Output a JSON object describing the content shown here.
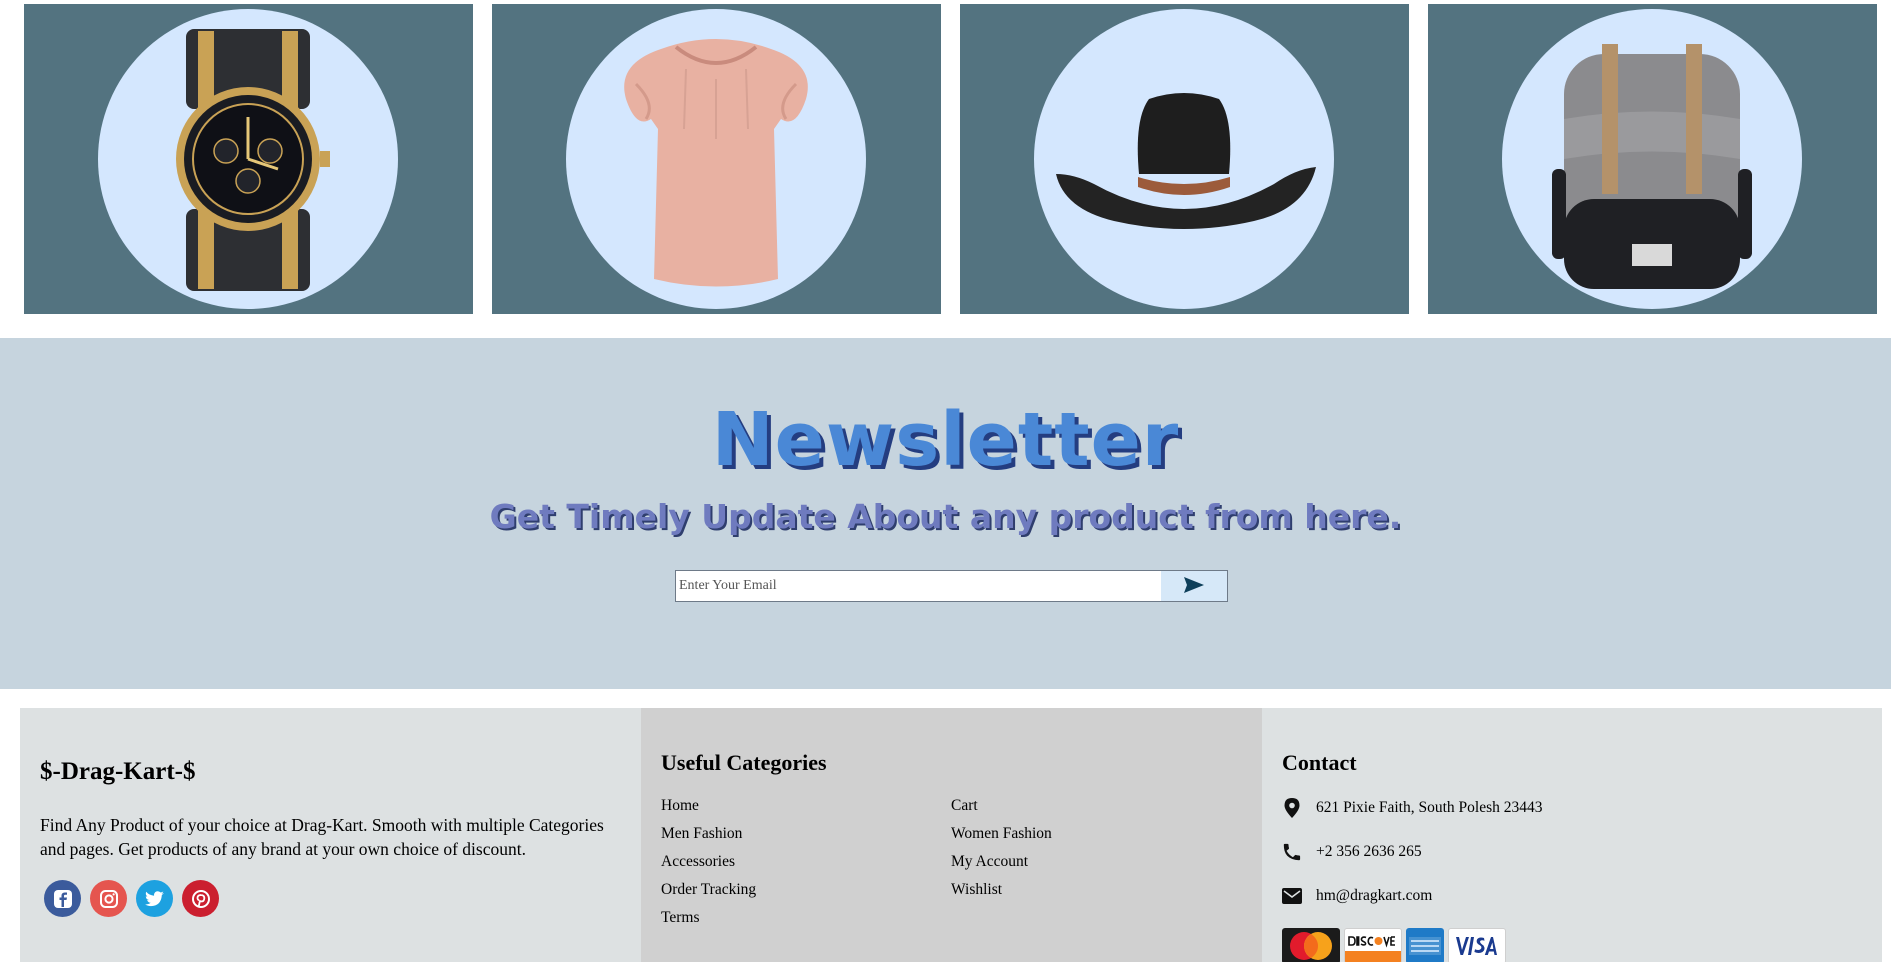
{
  "products": [
    {
      "name": "watch-image"
    },
    {
      "name": "blouse-image"
    },
    {
      "name": "hat-image"
    },
    {
      "name": "backpack-image"
    }
  ],
  "newsletter": {
    "title": "Newsletter",
    "subtitle": "Get Timely Update About any product from here.",
    "email_placeholder": "Enter Your Email",
    "send_icon": "send-arrow-icon"
  },
  "footer": {
    "brand": "$-Drag-Kart-$",
    "about": "Find Any Product of your choice at Drag-Kart. Smooth with multiple Categories and pages. Get products of any brand at your own choice of discount.",
    "socials": [
      "facebook-icon",
      "instagram-icon",
      "twitter-icon",
      "pinterest-icon"
    ],
    "useful_title": "Useful Categories",
    "links_col1": [
      "Home",
      "Men Fashion",
      "Accessories",
      "Order Tracking",
      "Terms"
    ],
    "links_col2": [
      "Cart",
      "Women Fashion",
      "My Account",
      "Wishlist"
    ],
    "contact_title": "Contact",
    "address": "621 Pixie Faith, South Polesh 23443",
    "phone": "+2 356 2636 265",
    "email": "hm@dragkart.com",
    "payment_cards": [
      "mastercard-logo",
      "discover-logo",
      "amex-logo",
      "visa-logo"
    ]
  },
  "colors": {
    "tile_bg": "#537380",
    "circle_bg": "#d4e7fe",
    "newsletter_bg": "#c6d4de",
    "title_blue": "#4a88d6"
  }
}
